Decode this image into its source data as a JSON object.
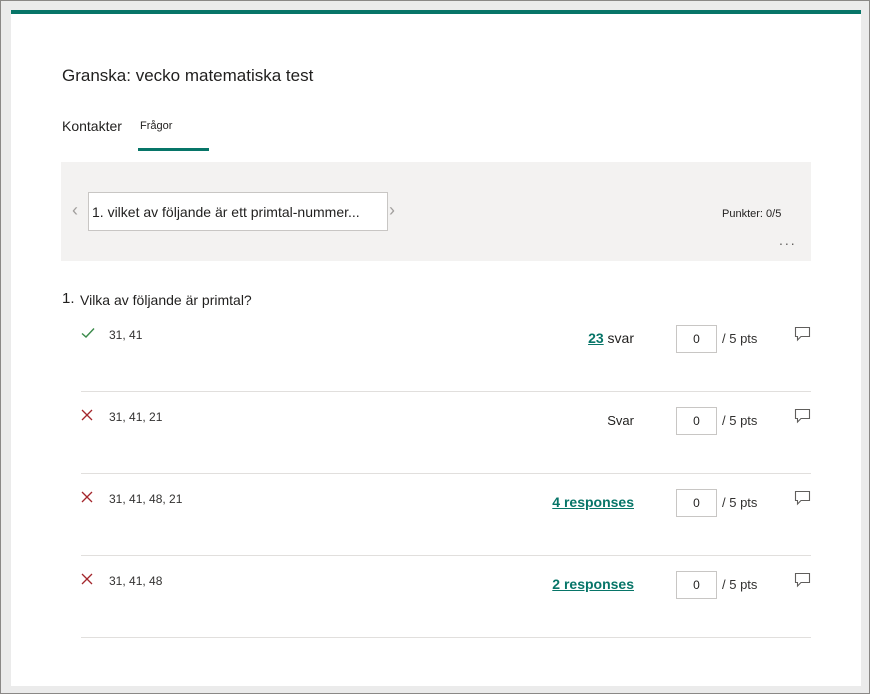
{
  "header": {
    "title": "Granska: vecko matematiska test"
  },
  "tabs": [
    {
      "label": "Kontakter"
    },
    {
      "label": "Frågor"
    }
  ],
  "navigator": {
    "current_question": "1. vilket av följande är ett primtal-nummer...",
    "points": "Punkter: 0/5",
    "more": "..."
  },
  "question": {
    "number": "1.",
    "text": "Vilka av följande är primtal?",
    "answers": [
      {
        "status": "correct",
        "icon": "checkmark-icon",
        "text": "31, 41",
        "resp_count": "23",
        "resp_suffix": " svar",
        "score": "0",
        "max": "/ 5 pts"
      },
      {
        "status": "wrong",
        "icon": "cross-icon",
        "text": "31, 41, 21",
        "resp_count": "",
        "resp_suffix": "Svar",
        "score": "0",
        "max": "/ 5 pts"
      },
      {
        "status": "wrong",
        "icon": "cross-icon",
        "text": "31, 41, 48, 21",
        "resp_count": "4 responses",
        "resp_suffix": "",
        "score": "0",
        "max": "/ 5 pts"
      },
      {
        "status": "wrong",
        "icon": "cross-icon",
        "text": "31, 41, 48",
        "resp_count": "2 responses",
        "resp_suffix": "",
        "score": "0",
        "max": "/ 5 pts"
      }
    ]
  },
  "colors": {
    "accent": "#077568",
    "correct": "#3a8a4a",
    "wrong": "#a4262c"
  }
}
